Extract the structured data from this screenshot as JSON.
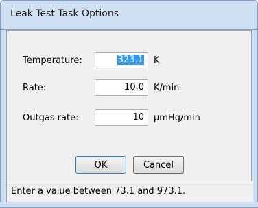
{
  "dialog": {
    "title": "Leak Test Task Options"
  },
  "fields": [
    {
      "label": "Temperature:",
      "value": "323.1",
      "unit": "K",
      "selected": true
    },
    {
      "label": "Rate:",
      "value": "10.0",
      "unit": "K/min",
      "selected": false
    },
    {
      "label": "Outgas rate:",
      "value": "10",
      "unit": "µmHg/min",
      "selected": false
    }
  ],
  "buttons": {
    "ok": "OK",
    "cancel": "Cancel"
  },
  "status": {
    "text": "Enter a value between 73.1 and 973.1."
  },
  "colors": {
    "titlebar": "#cfe0f4",
    "selection": "#3399ff",
    "dialog_bg": "#f0f0f0"
  }
}
